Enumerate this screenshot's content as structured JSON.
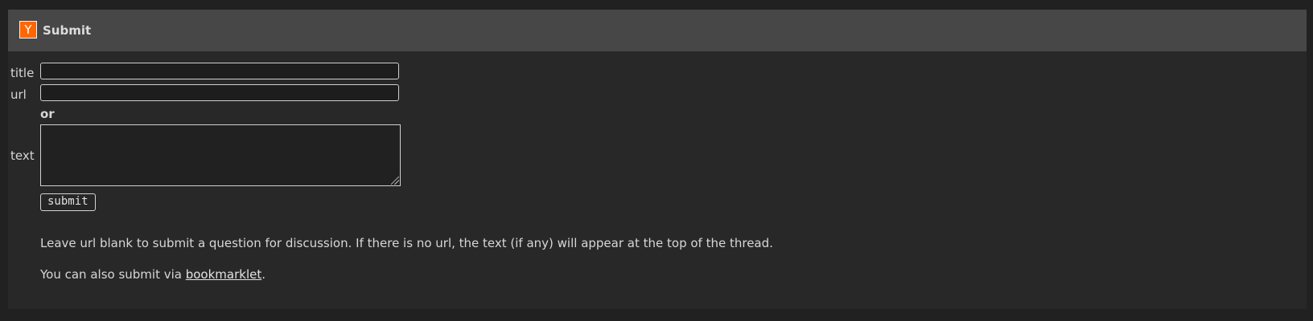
{
  "header": {
    "logo_letter": "Y",
    "title": "Submit"
  },
  "form": {
    "title_label": "title",
    "url_label": "url",
    "or_label": "or",
    "text_label": "text",
    "title_value": "",
    "url_value": "",
    "text_value": "",
    "submit_label": "submit"
  },
  "help": {
    "line1": "Leave url blank to submit a question for discussion. If there is no url, the text (if any) will appear at the top of the thread.",
    "line2_prefix": "You can also submit via ",
    "bookmarklet_link": "bookmarklet",
    "line2_suffix": "."
  },
  "colors": {
    "brand": "#ff6600",
    "background": "#282828",
    "header": "#474747"
  }
}
